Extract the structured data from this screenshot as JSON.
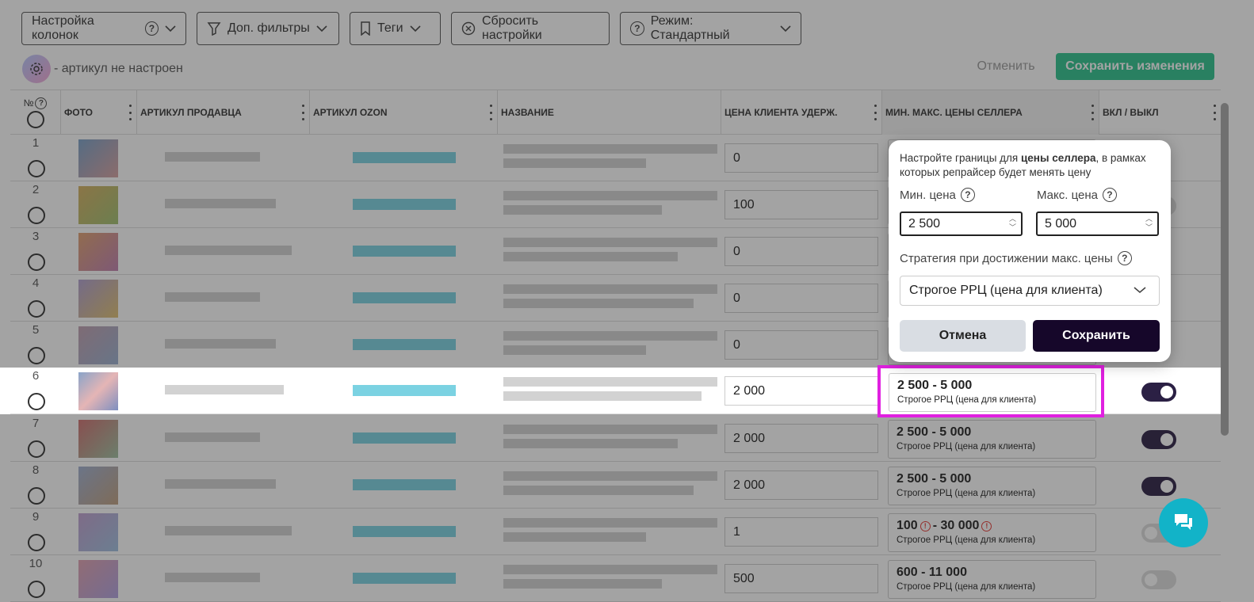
{
  "toolbar": {
    "columns_label": "Настройка колонок",
    "filters_label": "Доп. фильтры",
    "tags_label": "Теги",
    "reset_label": "Сбросить настройки",
    "mode_label": "Режим: Стандартный"
  },
  "notice": {
    "text": "- артикул не настроен"
  },
  "actions": {
    "cancel_label": "Отменить",
    "save_label": "Сохранить изменения"
  },
  "table": {
    "headers": {
      "no": "№",
      "photo": "ФОТО",
      "seller_sku": "АРТИКУЛ ПРОДАВЦА",
      "ozon_sku": "АРТИКУЛ OZON",
      "name": "НАЗВАНИЕ",
      "client_price": "ЦЕНА КЛИЕНТА УДЕРЖ.",
      "seller_minmax": "МИН. МАКС. ЦЕНЫ СЕЛЛЕРА",
      "toggle": "ВКЛ / ВЫКЛ"
    },
    "rows": [
      {
        "n": "1",
        "client_price": "0"
      },
      {
        "n": "2",
        "client_price": "100"
      },
      {
        "n": "3",
        "client_price": "0"
      },
      {
        "n": "4",
        "client_price": "0"
      },
      {
        "n": "5",
        "client_price": "0"
      },
      {
        "n": "6",
        "client_price": "2 000",
        "range": "2 500 - 5 000",
        "strategy": "Строгое РРЦ (цена для клиента)"
      },
      {
        "n": "7",
        "client_price": "2 000",
        "range": "2 500 - 5 000",
        "strategy": "Строгое РРЦ (цена для клиента)"
      },
      {
        "n": "8",
        "client_price": "2 000",
        "range": "2 500 - 5 000",
        "strategy": "Строгое РРЦ (цена для клиента)"
      },
      {
        "n": "9",
        "client_price": "1",
        "range_min": "100",
        "range_sep": "- 30 000",
        "strategy": "Строгое РРЦ (цена для клиента)"
      },
      {
        "n": "10",
        "client_price": "500",
        "range": "600 - 11 000",
        "strategy": "Строгое РРЦ (цена для клиента)"
      }
    ]
  },
  "popup": {
    "title_pre": "Настройте границы для ",
    "title_bold": "цены селлера",
    "title_post": ", в рамках которых репрайсер будет менять цену",
    "min_label": "Мин. цена",
    "max_label": "Макс. цена",
    "min_value": "2 500",
    "max_value": "5 000",
    "strategy_label": "Стратегия при достижении макс. цены",
    "strategy_value": "Строгое РРЦ (цена для клиента)",
    "cancel_label": "Отмена",
    "save_label": "Сохранить"
  },
  "colors": {
    "accent": "#16072a",
    "highlight": "#e020e0",
    "save": "#2ec38d",
    "chat": "#12b3c8"
  },
  "icons": [
    "help-icon",
    "chevron-down-icon",
    "filter-icon",
    "bookmark-icon",
    "close-circle-icon",
    "gear-icon",
    "chat-icon"
  ]
}
